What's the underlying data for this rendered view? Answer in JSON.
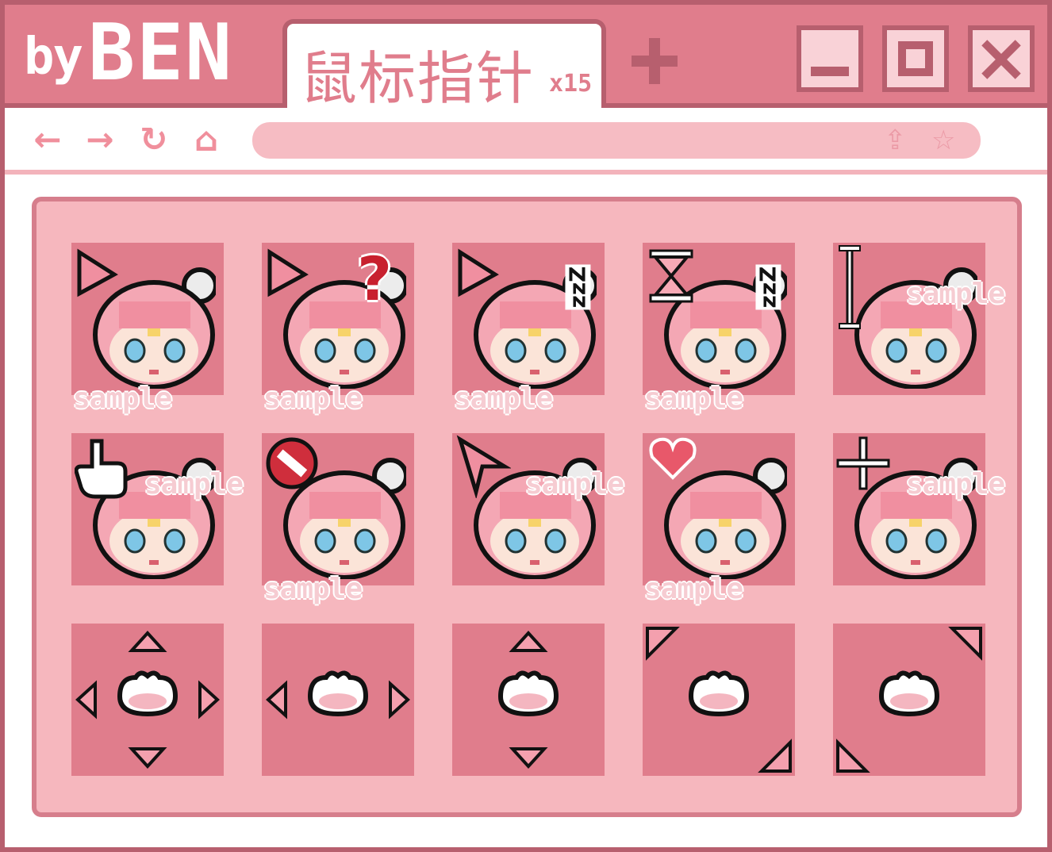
{
  "window": {
    "brand_by": "by",
    "brand_name": "BEN",
    "tab_title": "鼠标指针",
    "tab_count": "x15",
    "colors": {
      "frame": "#b75f6e",
      "bar": "#e07d8c",
      "panel": "#f6b7be",
      "cell": "#e07d8c",
      "button": "#f9d2d7"
    }
  },
  "nav": {
    "back_icon": "arrow-left-icon",
    "forward_icon": "arrow-right-icon",
    "reload_icon": "reload-icon",
    "home_icon": "home-icon",
    "share_icon": "share-icon",
    "star_icon": "star-icon"
  },
  "watermark": "sample",
  "cursors": [
    {
      "name": "normal-select",
      "icon": "arrow-icon",
      "watermark": "sample"
    },
    {
      "name": "help-select",
      "icon": "question-mark-icon",
      "watermark": "sample",
      "badge": "?"
    },
    {
      "name": "working-in-background",
      "icon": "arrow-zzz-icon",
      "watermark": "sample",
      "badge": "zzZ"
    },
    {
      "name": "busy",
      "icon": "hourglass-icon",
      "watermark": "sample",
      "badge": "zzZ"
    },
    {
      "name": "text-select",
      "icon": "i-beam-icon",
      "watermark": "sample"
    },
    {
      "name": "link-select",
      "icon": "hand-pointer-icon",
      "watermark": "sample"
    },
    {
      "name": "unavailable",
      "icon": "no-entry-icon",
      "watermark": "sample"
    },
    {
      "name": "alternate-select",
      "icon": "up-arrow-icon",
      "watermark": "sample"
    },
    {
      "name": "person-select",
      "icon": "heart-icon",
      "watermark": "sample"
    },
    {
      "name": "precision-select",
      "icon": "crosshair-icon",
      "watermark": "sample"
    },
    {
      "name": "move",
      "icon": "paw-move-icon"
    },
    {
      "name": "horizontal-resize",
      "icon": "paw-horizontal-icon"
    },
    {
      "name": "vertical-resize",
      "icon": "paw-vertical-icon"
    },
    {
      "name": "diagonal-resize-1",
      "icon": "paw-diagonal-1-icon"
    },
    {
      "name": "diagonal-resize-2",
      "icon": "paw-diagonal-2-icon"
    }
  ]
}
